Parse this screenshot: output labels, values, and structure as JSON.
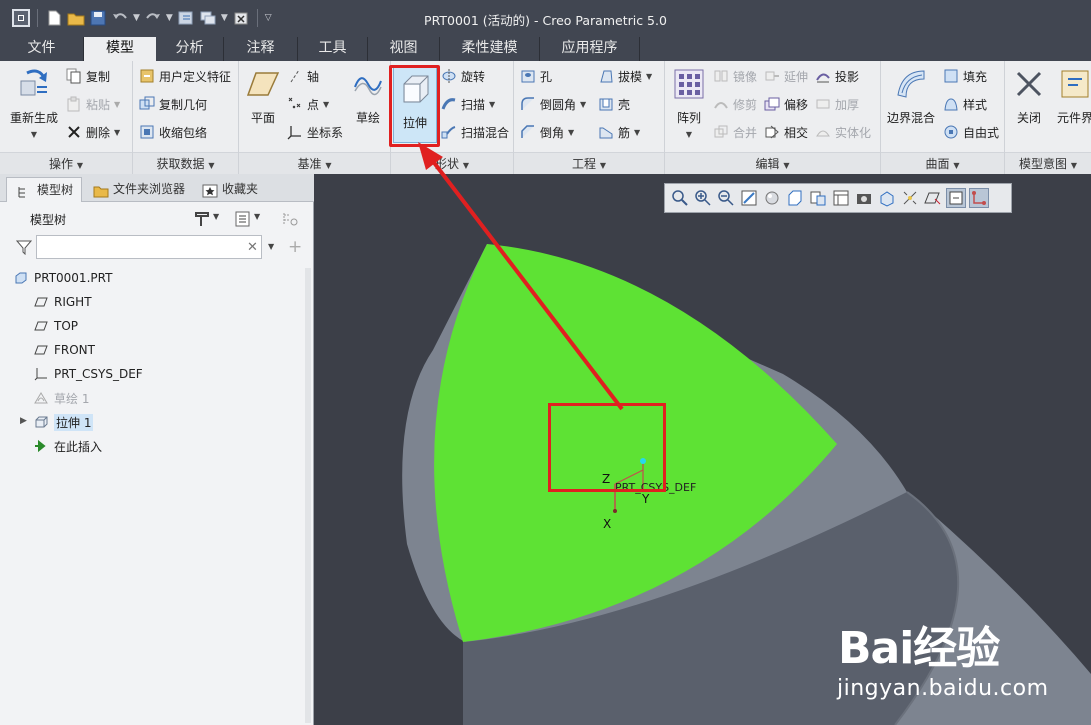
{
  "window": {
    "title": "PRT0001 (活动的) - Creo Parametric 5.0"
  },
  "tabs": [
    {
      "label": "文件"
    },
    {
      "label": "模型"
    },
    {
      "label": "分析"
    },
    {
      "label": "注释"
    },
    {
      "label": "工具"
    },
    {
      "label": "视图"
    },
    {
      "label": "柔性建模"
    },
    {
      "label": "应用程序"
    }
  ],
  "ribbon": {
    "operations": {
      "label": "操作",
      "regenerate": "重新生成",
      "copy": "复制",
      "paste": "粘贴",
      "delete": "删除"
    },
    "get_data": {
      "label": "获取数据",
      "udf": "用户定义特征",
      "copy_geom": "复制几何",
      "shrinkwrap": "收缩包络"
    },
    "datum": {
      "label": "基准",
      "plane": "平面",
      "axis": "轴",
      "point": "点",
      "csys": "坐标系",
      "sketch": "草绘"
    },
    "shapes": {
      "label": "形状",
      "extrude": "拉伸",
      "revolve": "旋转",
      "sweep": "扫描",
      "swept_blend": "扫描混合"
    },
    "engineering": {
      "label": "工程",
      "hole": "孔",
      "round": "倒圆角",
      "chamfer": "倒角",
      "draft": "拔模",
      "shell": "壳",
      "rib": "筋"
    },
    "editing": {
      "label": "编辑",
      "pattern": "阵列",
      "mirror": "镜像",
      "extend": "延伸",
      "project": "投影",
      "trim": "修剪",
      "offset": "偏移",
      "thicken": "加厚",
      "merge": "合并",
      "intersect": "相交",
      "solidify": "实体化"
    },
    "surfaces": {
      "label": "曲面",
      "boundary_blend": "边界混合",
      "fill": "填充",
      "style": "样式",
      "freestyle": "自由式"
    },
    "model_intent": {
      "label": "模型意图",
      "close": "关闭",
      "component": "元件界"
    }
  },
  "panel": {
    "tabs": [
      {
        "label": "模型树"
      },
      {
        "label": "文件夹浏览器"
      },
      {
        "label": "收藏夹"
      }
    ],
    "title": "模型树",
    "filter_value": "",
    "tree": [
      {
        "label": "PRT0001.PRT"
      },
      {
        "label": "RIGHT"
      },
      {
        "label": "TOP"
      },
      {
        "label": "FRONT"
      },
      {
        "label": "PRT_CSYS_DEF"
      },
      {
        "label": "草绘 1"
      },
      {
        "label": "拉伸 1"
      },
      {
        "label": "在此插入"
      }
    ]
  },
  "viewport": {
    "csys_label": "PRT_CSYS_DEF",
    "axis_z": "Z",
    "axis_y": "Y",
    "axis_x": "X"
  },
  "watermark": {
    "logo": "Bai经验",
    "url": "jingyan.baidu.com"
  },
  "colors": {
    "accent_red": "#e02020",
    "face_green": "#5ee234",
    "body_grey": "#7d8490"
  }
}
